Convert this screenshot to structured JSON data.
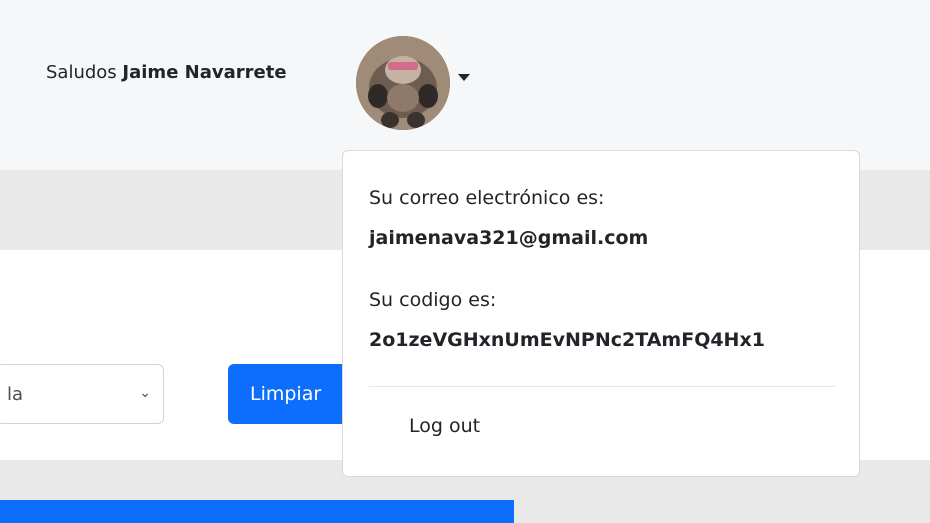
{
  "header": {
    "greeting_prefix": "Saludos",
    "user_name": "Jaime Navarrete"
  },
  "filter": {
    "select_value": "la",
    "clear_button": "Limpiar"
  },
  "user_menu": {
    "email_label": "Su correo electrónico es:",
    "email_value": "jaimenava321@gmail.com",
    "code_label": "Su codigo es:",
    "code_value": "2o1zeVGHxnUmEvNPNc2TAmFQ4Hx1",
    "logout": "Log out"
  },
  "icons": {
    "avatar": "user-avatar",
    "caret": "caret-down-icon",
    "select_chevron": "chevron-down-icon"
  }
}
